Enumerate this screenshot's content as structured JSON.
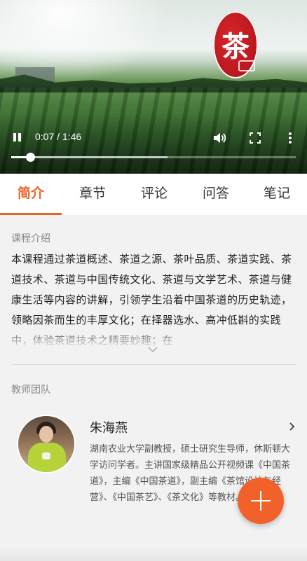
{
  "video": {
    "seal_char": "茶",
    "time_current": "0:07",
    "time_total": "1:46",
    "time_sep": " / ",
    "progress": 0.067,
    "buffered": 0.55
  },
  "tabs": [
    {
      "label": "简介",
      "active": true
    },
    {
      "label": "章节",
      "active": false
    },
    {
      "label": "评论",
      "active": false
    },
    {
      "label": "问答",
      "active": false
    },
    {
      "label": "笔记",
      "active": false
    }
  ],
  "intro": {
    "title": "课程介绍",
    "text": "本课程通过茶道概述、茶道之源、茶叶品质、茶道实践、茶道技术、茶道与中国传统文化、茶道与文学艺术、茶道与健康生活等内容的讲解，引领学生沿着中国茶道的历史轨迹，领略因茶而生的丰厚文化；在择器选水、高冲低斟的实践中，体验茶道技术之精要妙趣；在"
  },
  "team": {
    "title": "教师团队",
    "teacher": {
      "name": "朱海燕",
      "bio": "湖南农业大学副教授，硕士研究生导师，休斯顿大学访问学者。主讲国家级精品公开视频课《中国茶道》，主编《中国茶道》，副主编《茶馆设计与经营》、《中国茶艺》、《茶文化》等教材。"
    }
  },
  "icons": {
    "pause": "pause-icon",
    "volume": "volume-icon",
    "fullscreen": "fullscreen-icon",
    "more": "more-vertical-icon",
    "expand": "chevron-down-icon",
    "teacher_arrow": "chevron-right-icon",
    "fab": "plus-icon"
  },
  "colors": {
    "accent": "#e8642a",
    "fab": "#f0622a",
    "seal": "#c61b22"
  }
}
